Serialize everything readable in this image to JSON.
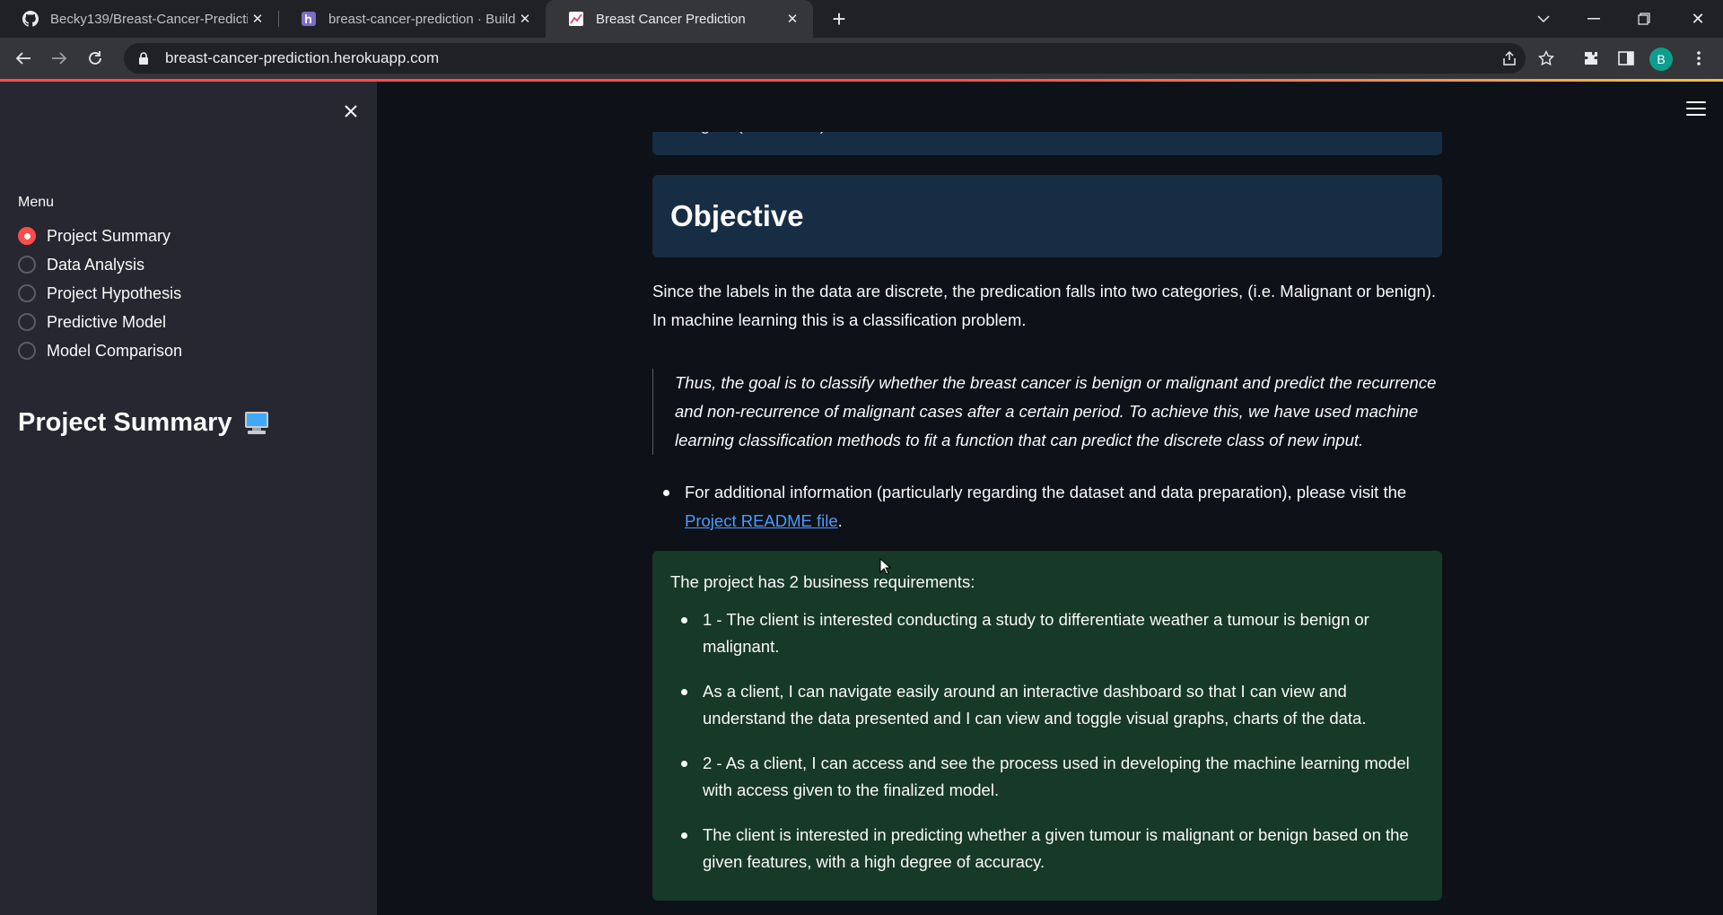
{
  "browser": {
    "tabs": [
      {
        "title": "Becky139/Breast-Cancer-Predicti",
        "icon": "github-icon"
      },
      {
        "title": "breast-cancer-prediction · Build |",
        "icon": "heroku-icon"
      },
      {
        "title": "Breast Cancer Prediction",
        "icon": "streamlit-chart-icon"
      }
    ],
    "url": "breast-cancer-prediction.herokuapp.com",
    "avatar_letter": "B"
  },
  "sidebar": {
    "menu_label": "Menu",
    "options": [
      {
        "label": "Project Summary",
        "selected": true
      },
      {
        "label": "Data Analysis",
        "selected": false
      },
      {
        "label": "Project Hypothesis",
        "selected": false
      },
      {
        "label": "Predictive Model",
        "selected": false
      },
      {
        "label": "Model Comparison",
        "selected": false
      }
    ],
    "heading": "Project Summary"
  },
  "main": {
    "prev_box_cut_text": "…ng… (…………)…",
    "objective_heading": "Objective",
    "objective_para": "Since the labels in the data are discrete, the predication falls into two categories, (i.e. Malignant or benign). In machine learning this is a classification problem.",
    "quote": "Thus, the goal is to classify whether the breast cancer is benign or malignant and predict the recurrence and non-recurrence of malignant cases after a certain period. To achieve this, we have used machine learning classification methods to fit a function that can predict the discrete class of new input.",
    "info_bullet_text": "For additional information (particularly regarding the dataset and data preparation), please visit the ",
    "info_link": "Project README file",
    "info_tail": ".",
    "requirements_lead": "The project has 2 business requirements:",
    "requirements": [
      "1 - The client is interested conducting a study to differentiate weather a tumour is benign or malignant.",
      "As a client, I can navigate easily around an interactive dashboard so that I can view and understand the data presented and I can view and toggle visual graphs, charts of the data.",
      "2 - As a client, I can access and see the process used in developing the machine learning model with access given to the finalized model.",
      "The client is interested in predicting whether a given tumour is malignant or benign based on the given features, with a high degree of accuracy."
    ]
  },
  "colors": {
    "accent": "#ff4b4b",
    "sidebar_bg": "#262730",
    "main_bg": "#0e1117",
    "info_box": "#172d43",
    "success_box": "#173928",
    "link": "#4a9cff"
  }
}
